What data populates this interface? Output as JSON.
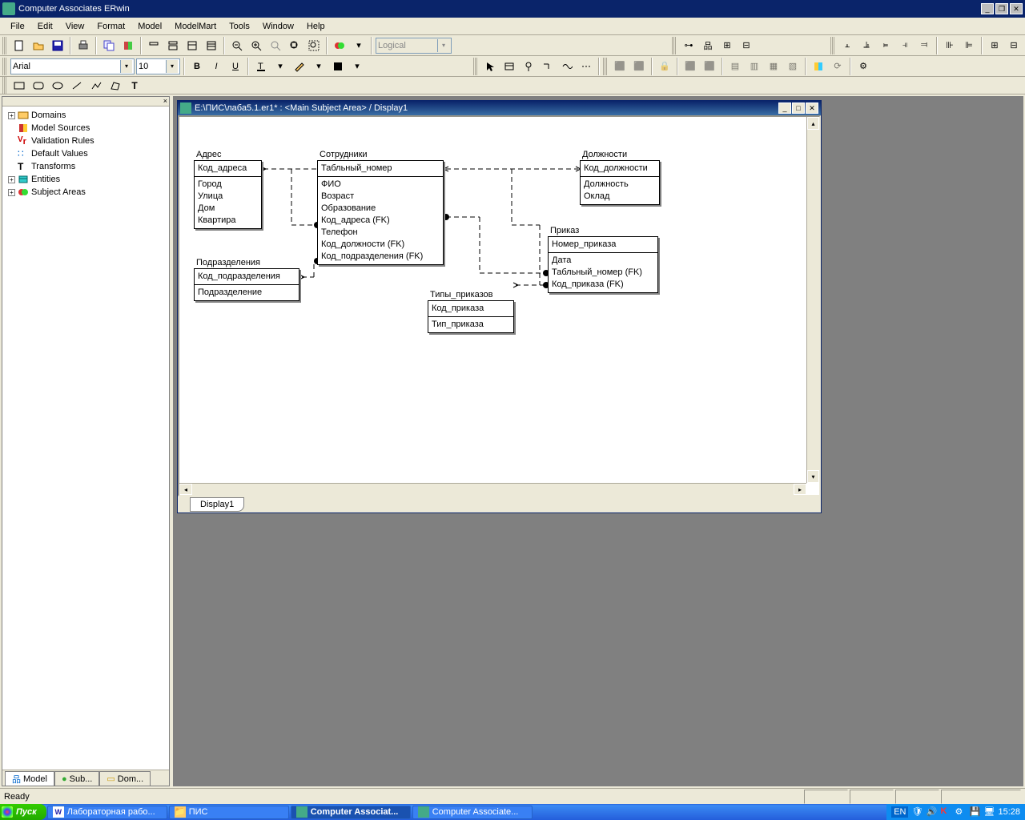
{
  "app": {
    "title": "Computer Associates ERwin"
  },
  "menu": [
    "File",
    "Edit",
    "View",
    "Format",
    "Model",
    "ModelMart",
    "Tools",
    "Window",
    "Help"
  ],
  "toolbar2": {
    "font": "Arial",
    "size": "10",
    "model_type": "Logical"
  },
  "tree": [
    {
      "exp": "+",
      "icon": "domains",
      "label": "Domains"
    },
    {
      "exp": "",
      "icon": "sources",
      "label": "Model Sources"
    },
    {
      "exp": "",
      "icon": "validation",
      "label": "Validation Rules"
    },
    {
      "exp": "",
      "icon": "defaults",
      "label": "Default Values"
    },
    {
      "exp": "",
      "icon": "transforms",
      "label": "Transforms"
    },
    {
      "exp": "+",
      "icon": "entities",
      "label": "Entities"
    },
    {
      "exp": "+",
      "icon": "subject",
      "label": "Subject Areas"
    }
  ],
  "side_tabs": [
    {
      "label": "Model",
      "active": true
    },
    {
      "label": "Sub...",
      "active": false
    },
    {
      "label": "Dom...",
      "active": false
    }
  ],
  "doc": {
    "title": "E:\\ПИС\\лаба5.1.er1* : <Main Subject Area> / Display1",
    "tab": "Display1"
  },
  "entities": {
    "address": {
      "name": "Адрес",
      "pk": [
        "Код_адреса"
      ],
      "attrs": [
        "Город",
        "Улица",
        "Дом",
        "Квартира"
      ]
    },
    "staff": {
      "name": "Сотрудники",
      "pk": [
        "Табльный_номер"
      ],
      "attrs": [
        "ФИО",
        "Возраст",
        "Образование",
        "Код_адреса (FK)",
        "Телефон",
        "Код_должности (FK)",
        "Код_подразделения (FK)"
      ]
    },
    "position": {
      "name": "Должности",
      "pk": [
        "Код_должности"
      ],
      "attrs": [
        "Должность",
        "Оклад"
      ]
    },
    "dept": {
      "name": "Подразделения",
      "pk": [
        "Код_подразделения"
      ],
      "attrs": [
        "Подразделение"
      ]
    },
    "order": {
      "name": "Приказ",
      "pk": [
        "Номер_приказа"
      ],
      "attrs": [
        "Дата",
        "Табльный_номер (FK)",
        "Код_приказа (FK)"
      ]
    },
    "ordertype": {
      "name": "Типы_приказов",
      "pk": [
        "Код_приказа"
      ],
      "attrs": [
        "Тип_приказа"
      ]
    }
  },
  "status": "Ready",
  "taskbar": {
    "start": "Пуск",
    "buttons": [
      {
        "label": "Лабораторная рабо...",
        "active": false
      },
      {
        "label": "ПИС",
        "active": false
      },
      {
        "label": "Computer Associat...",
        "active": true
      },
      {
        "label": "Computer Associate...",
        "active": false
      }
    ],
    "lang": "EN",
    "time": "15:28"
  }
}
